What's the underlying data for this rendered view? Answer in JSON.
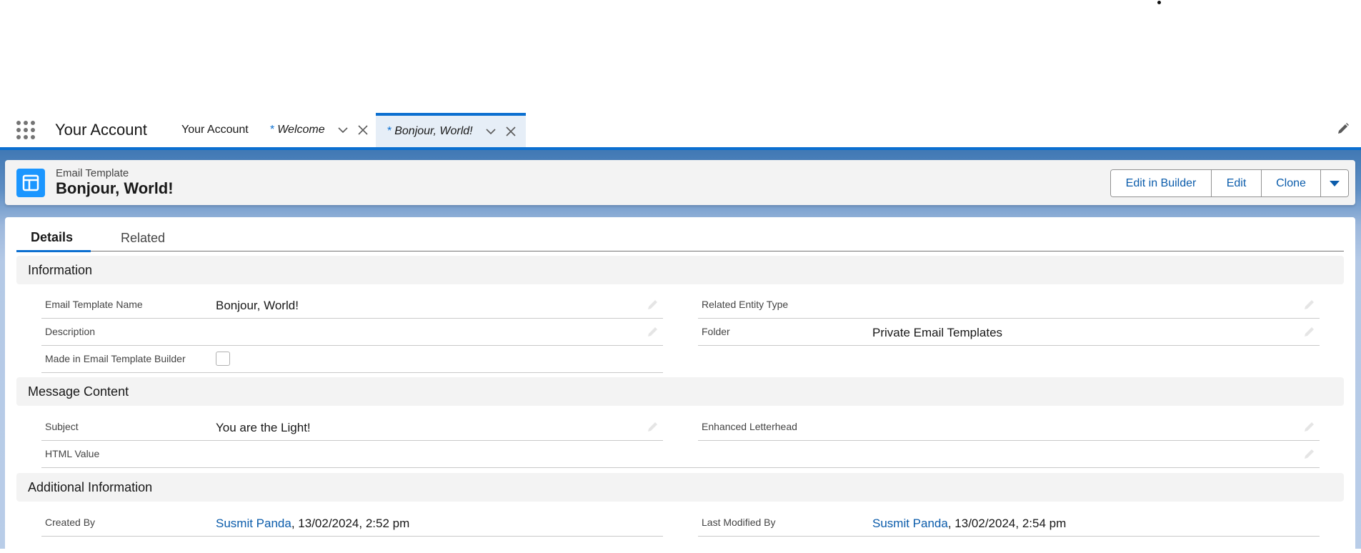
{
  "nav": {
    "app_name": "Your Account",
    "tabs": [
      {
        "label": "Your Account",
        "unsaved": false,
        "active": false
      },
      {
        "label": "Welcome",
        "unsaved": true,
        "active": false
      },
      {
        "label": "Bonjour, World!",
        "unsaved": true,
        "active": true
      }
    ],
    "unsaved_marker": "*",
    "chevron_glyph": "⌄",
    "close_glyph": "✕"
  },
  "header": {
    "object_type": "Email Template",
    "record_title": "Bonjour, World!",
    "icon": "email-template-icon",
    "actions": [
      "Edit in Builder",
      "Edit",
      "Clone"
    ],
    "more_glyph": "▼"
  },
  "tabs": {
    "details": "Details",
    "related": "Related",
    "active": "Details"
  },
  "sections": {
    "information": {
      "title": "Information",
      "fields": {
        "email_template_name": {
          "label": "Email Template Name",
          "value": "Bonjour, World!"
        },
        "related_entity_type": {
          "label": "Related Entity Type",
          "value": ""
        },
        "description": {
          "label": "Description",
          "value": ""
        },
        "folder": {
          "label": "Folder",
          "value": "Private Email Templates"
        },
        "made_in_builder": {
          "label": "Made in Email Template Builder",
          "checked": false
        }
      }
    },
    "message_content": {
      "title": "Message Content",
      "fields": {
        "subject": {
          "label": "Subject",
          "value": "You are the Light!"
        },
        "enhanced_letterhead": {
          "label": "Enhanced Letterhead",
          "value": ""
        },
        "html_value": {
          "label": "HTML Value",
          "value": ""
        }
      }
    },
    "additional_information": {
      "title": "Additional Information",
      "fields": {
        "created_by": {
          "label": "Created By",
          "user": "Susmit Panda",
          "timestamp": ", 13/02/2024, 2:52 pm"
        },
        "last_modified_by": {
          "label": "Last Modified By",
          "user": "Susmit Panda",
          "timestamp": ", 13/02/2024, 2:54 pm"
        }
      }
    }
  },
  "colors": {
    "brand": "#0b6fd0",
    "link": "#0b5cab",
    "icon_bg": "#1b96ff"
  }
}
